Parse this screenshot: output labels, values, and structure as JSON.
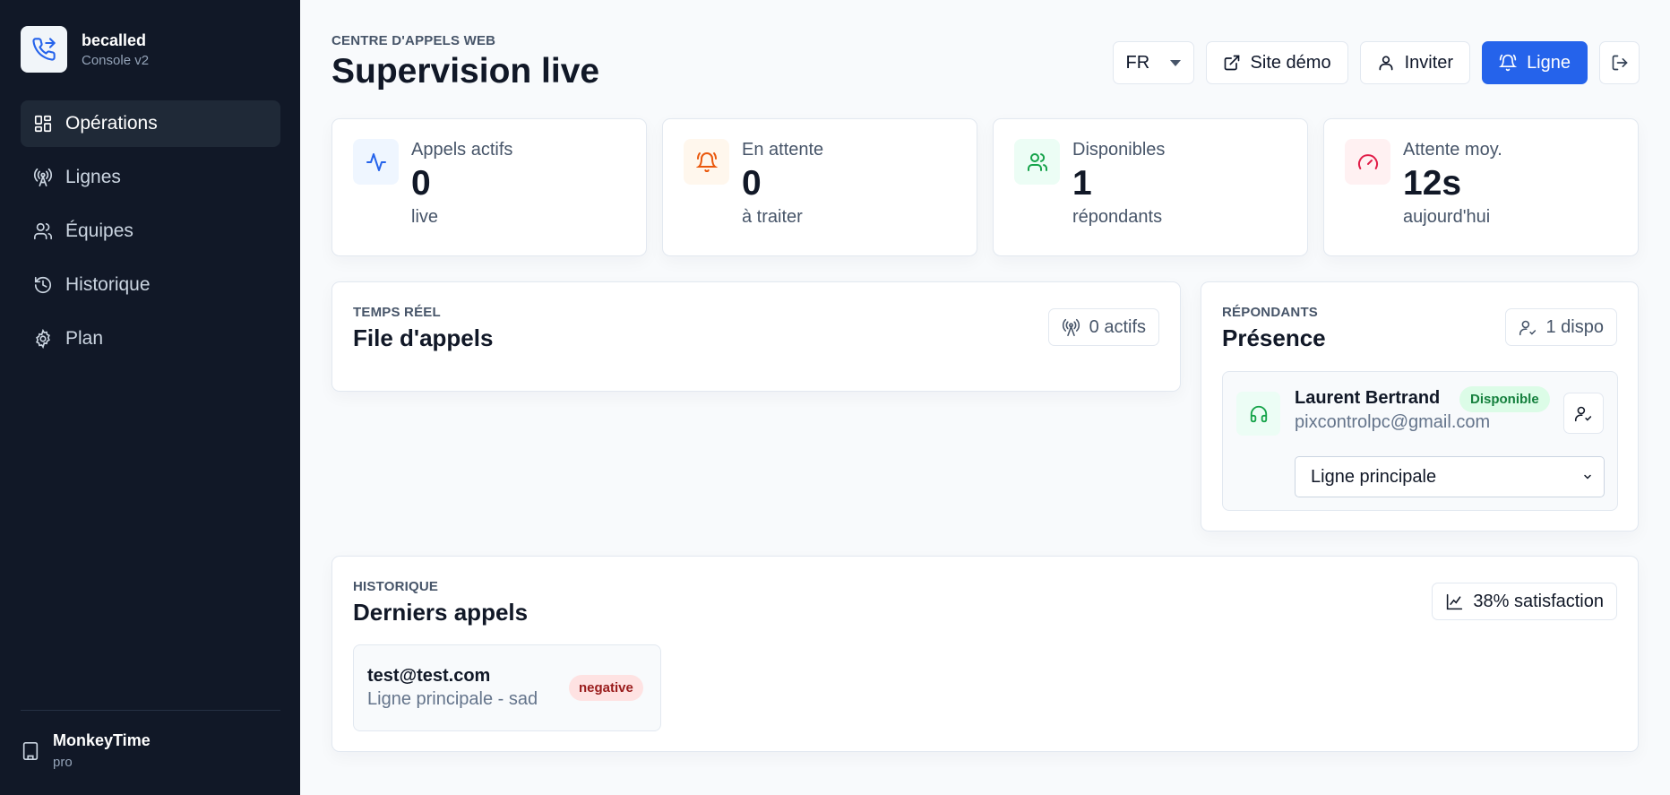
{
  "sidebar": {
    "brand": {
      "name": "becalled",
      "subtitle": "Console v2",
      "icon": "phone-forward-icon"
    },
    "items": [
      {
        "label": "Opérations",
        "icon": "dashboard-grid-icon",
        "active": true
      },
      {
        "label": "Lignes",
        "icon": "radio-tower-icon",
        "active": false
      },
      {
        "label": "Équipes",
        "icon": "users-icon",
        "active": false
      },
      {
        "label": "Historique",
        "icon": "history-icon",
        "active": false
      },
      {
        "label": "Plan",
        "icon": "gear-icon",
        "active": false
      }
    ],
    "tenant": {
      "name": "MonkeyTime",
      "plan": "pro",
      "icon": "building-icon"
    }
  },
  "header": {
    "eyebrow": "CENTRE D'APPELS WEB",
    "title": "Supervision live",
    "language": "FR",
    "demo_label": "Site démo",
    "invite_label": "Inviter",
    "line_label": "Ligne"
  },
  "stats": [
    {
      "label": "Appels actifs",
      "value": "0",
      "sub": "live",
      "icon": "activity-icon",
      "color": "#2563eb",
      "bg": "#eff6ff"
    },
    {
      "label": "En attente",
      "value": "0",
      "sub": "à traiter",
      "icon": "bell-ring-icon",
      "color": "#ea580c",
      "bg": "#fff7ed"
    },
    {
      "label": "Disponibles",
      "value": "1",
      "sub": "répondants",
      "icon": "users-icon",
      "color": "#16a34a",
      "bg": "#ecfdf5"
    },
    {
      "label": "Attente moy.",
      "value": "12s",
      "sub": "aujourd'hui",
      "icon": "gauge-icon",
      "color": "#e11d48",
      "bg": "#fff1f2"
    }
  ],
  "queue": {
    "eyebrow": "TEMPS RÉEL",
    "title": "File d'appels",
    "active_pill": "0 actifs"
  },
  "presence": {
    "eyebrow": "RÉPONDANTS",
    "title": "Présence",
    "dispo_pill": "1 dispo",
    "agent": {
      "name": "Laurent Bertrand",
      "status": "Disponible",
      "email": "pixcontrolpc@gmail.com",
      "line": "Ligne principale"
    }
  },
  "history": {
    "eyebrow": "HISTORIQUE",
    "title": "Derniers appels",
    "satisfaction": "38% satisfaction",
    "calls": [
      {
        "email": "test@test.com",
        "sub": "Ligne principale - sad",
        "sentiment": "negative"
      }
    ]
  }
}
